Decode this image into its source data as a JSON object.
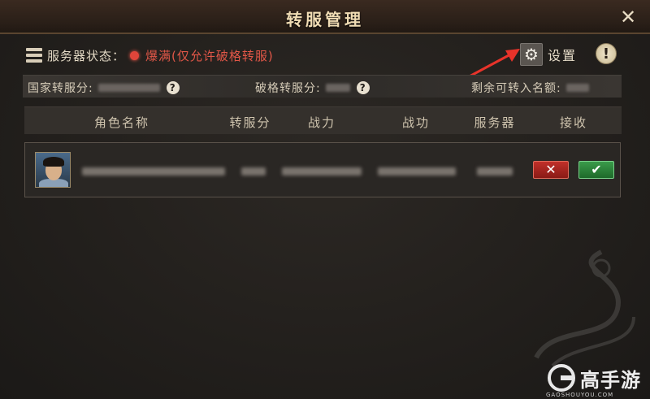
{
  "window": {
    "title": "转服管理"
  },
  "status": {
    "label": "服务器状态：",
    "value": "爆满(仅允许破格转服)",
    "dot_color": "#e0453a"
  },
  "settings": {
    "label": "设置",
    "icon": "gear-icon"
  },
  "info": {
    "glyph": "!"
  },
  "points": {
    "national_label": "国家转服分:",
    "special_label": "破格转服分:",
    "remaining_label": "剩余可转入名额:",
    "help_glyph": "?"
  },
  "table": {
    "headers": [
      "角色名称",
      "转服分",
      "战力",
      "战功",
      "服务器",
      "接收"
    ]
  },
  "row": {
    "reject_glyph": "✕",
    "accept_glyph": "✔"
  },
  "branding": {
    "name": "高手游",
    "url": "GAOSHOUYOU.COM"
  },
  "colors": {
    "status_red": "#e25748",
    "reject_red": "#c0302a",
    "accept_green": "#3a9a4a",
    "annotation_arrow": "#e8332a"
  }
}
